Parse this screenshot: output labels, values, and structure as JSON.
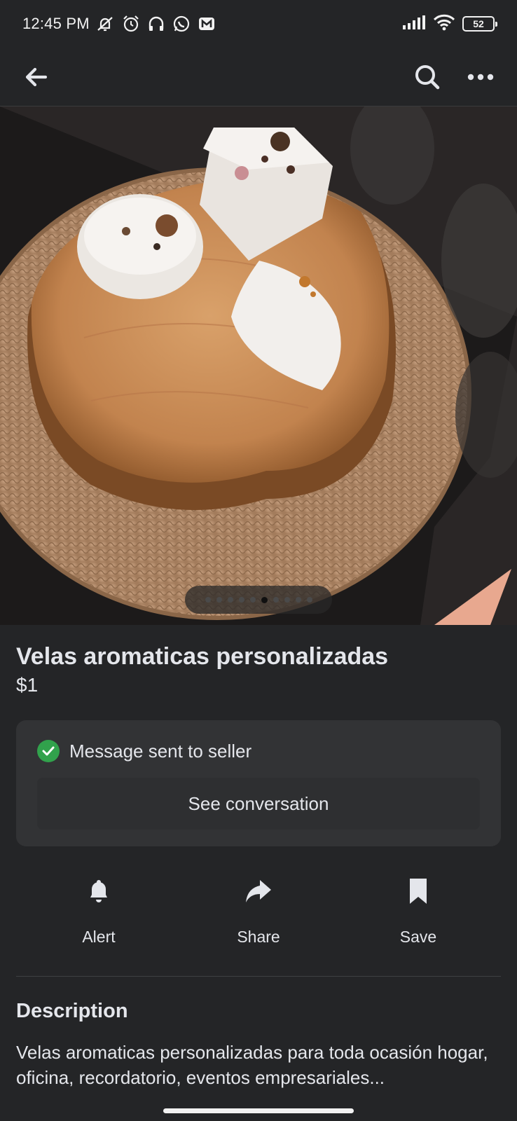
{
  "status_bar": {
    "time": "12:45 PM",
    "battery": "52",
    "icons": [
      "muted-notifications-icon",
      "alarm-icon",
      "headphones-icon",
      "whatsapp-icon",
      "app-m-icon",
      "signal-icon",
      "wifi-icon",
      "battery-icon"
    ]
  },
  "top_nav": {
    "back_icon": "arrow-left-icon",
    "search_icon": "search-icon",
    "more_icon": "more-horizontal-icon"
  },
  "gallery": {
    "total_photos": 10,
    "current_index": 5
  },
  "listing": {
    "title": "Velas aromaticas personalizadas",
    "price": "$1"
  },
  "message_card": {
    "status": "Message sent to seller",
    "button": "See conversation",
    "status_color": "#31a24c"
  },
  "actions": [
    {
      "label": "Alert",
      "icon": "bell-icon"
    },
    {
      "label": "Share",
      "icon": "share-arrow-icon"
    },
    {
      "label": "Save",
      "icon": "bookmark-icon"
    }
  ],
  "description": {
    "heading": "Description",
    "text": "Velas aromaticas personalizadas para toda ocasión hogar, oficina, recordatorio, eventos empresariales..."
  }
}
